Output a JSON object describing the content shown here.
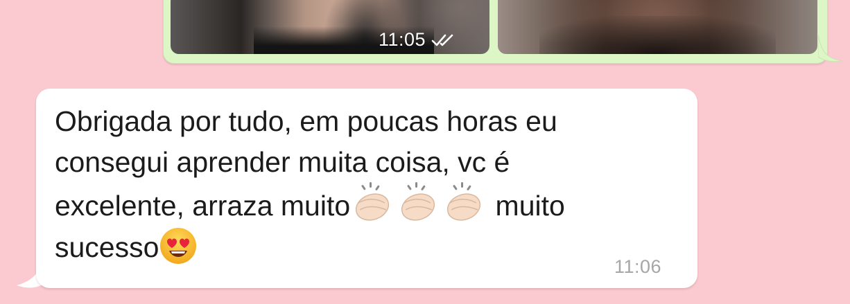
{
  "colors": {
    "background": "#fbc9d0",
    "outgoing_bubble": "#dcf7c5",
    "incoming_bubble": "#ffffff",
    "text": "#1b1b1b",
    "timestamp_incoming": "#a6a6a6"
  },
  "outgoing": {
    "time": "11:05",
    "status_icon": "double-check-read-icon",
    "photos": [
      {
        "name": "photo-1"
      },
      {
        "name": "photo-2"
      }
    ]
  },
  "incoming": {
    "lines": [
      "Obrigada por tudo, em poucas horas eu",
      "consegui aprender muita coisa, vc é",
      "excelente, arraza muito",
      " muito",
      "sucesso"
    ],
    "emojis": [
      "clapping-hands",
      "clapping-hands",
      "clapping-hands",
      "smiling-face-with-heart-eyes"
    ],
    "time": "11:06"
  }
}
